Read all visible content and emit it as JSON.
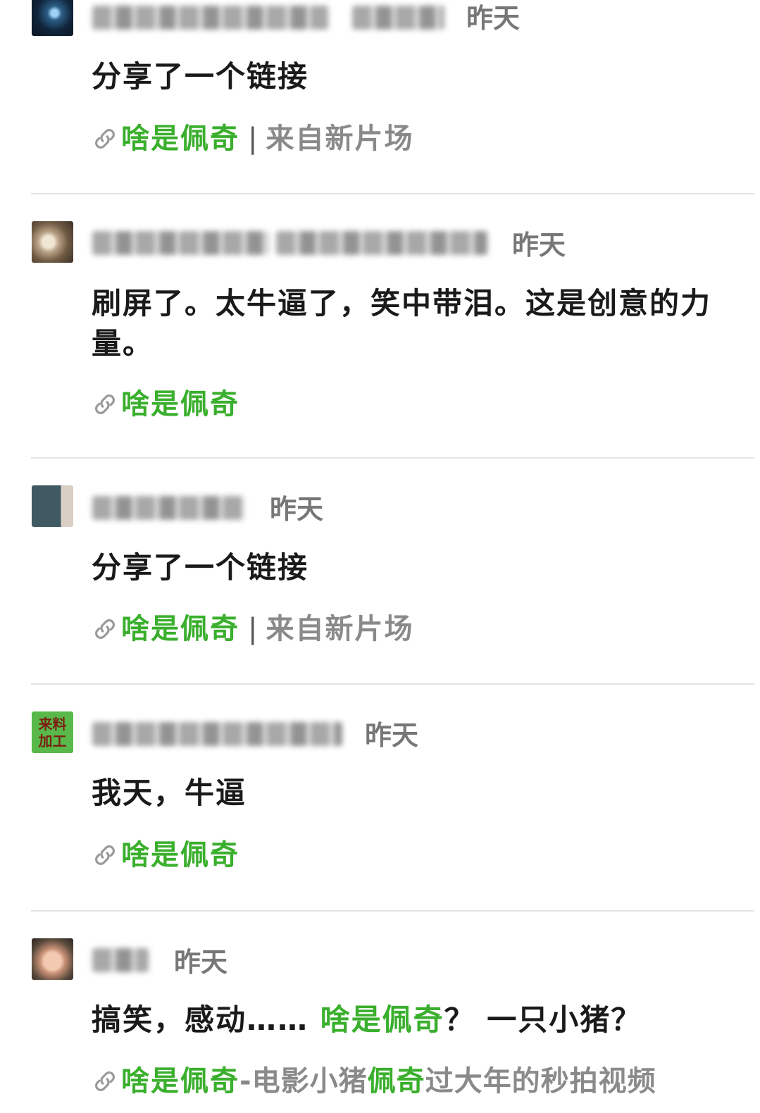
{
  "posts": [
    {
      "time": "昨天",
      "text": "分享了一个链接",
      "link": {
        "title": "啥是佩奇",
        "separator": "|",
        "source": "来自新片场"
      }
    },
    {
      "time": "昨天",
      "text": "刷屏了。太牛逼了，笑中带泪。这是创意的力量。",
      "link": {
        "title": "啥是佩奇"
      }
    },
    {
      "time": "昨天",
      "text": "分享了一个链接",
      "link": {
        "title": "啥是佩奇",
        "separator": "|",
        "source": "来自新片场"
      }
    },
    {
      "time": "昨天",
      "text": "我天，牛逼",
      "link": {
        "title": "啥是佩奇"
      },
      "avatar_text": "来料加工"
    },
    {
      "time": "昨天",
      "text_parts": [
        "搞笑，感动…… ",
        "啥是佩奇",
        "？ 一只小猪？"
      ],
      "link": {
        "title": "啥是佩奇",
        "sub_parts": [
          "-电影小猪",
          "佩奇",
          "过大年的秒拍视频"
        ]
      }
    }
  ],
  "colors": {
    "link_green": "#3aaf2d",
    "text": "#1a1a1a",
    "meta_gray": "#777777",
    "divider": "#e3e3e3"
  }
}
